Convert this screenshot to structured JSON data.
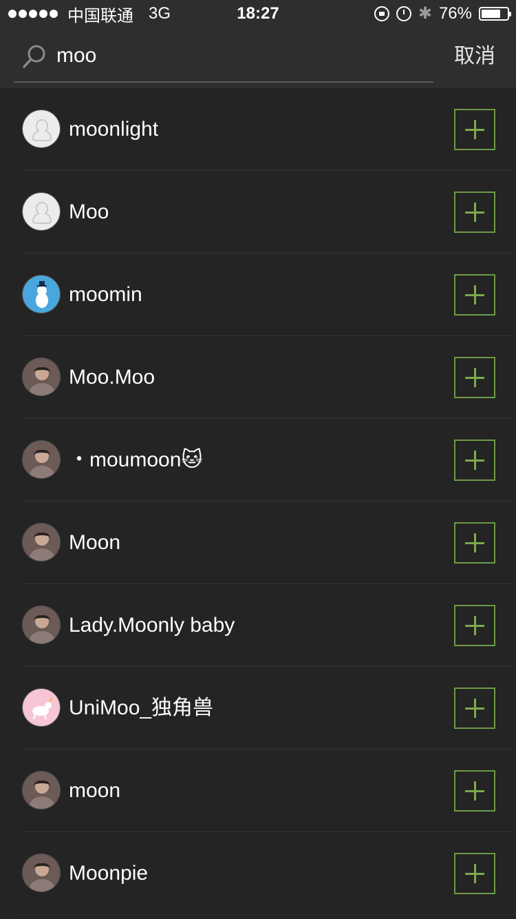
{
  "status_bar": {
    "carrier": "中国联通",
    "network": "3G",
    "time": "18:27",
    "battery_percent": "76%",
    "battery_level": 0.76,
    "bluetooth_icon": "bluetooth-icon"
  },
  "search": {
    "query": "moo",
    "cancel_label": "取消"
  },
  "colors": {
    "background": "#242424",
    "header": "#2e2e2e",
    "accent_green": "#6d9a45"
  },
  "results": [
    {
      "name": "moonlight",
      "avatar": "default-avatar-icon"
    },
    {
      "name": "Moo",
      "avatar": "default-avatar-icon"
    },
    {
      "name": "moomin",
      "avatar": "moomin-avatar"
    },
    {
      "name": "Moo.Moo",
      "avatar": "photo-avatar"
    },
    {
      "name": "・moumoon🐱",
      "avatar": "photo-avatar"
    },
    {
      "name": "Moon",
      "avatar": "photo-avatar"
    },
    {
      "name": "Lady.Moonly baby",
      "avatar": "photo-avatar"
    },
    {
      "name": "UniMoo_独角兽",
      "avatar": "unicorn-avatar"
    },
    {
      "name": "moon",
      "avatar": "photo-avatar"
    },
    {
      "name": "Moonpie",
      "avatar": "photo-avatar"
    }
  ]
}
